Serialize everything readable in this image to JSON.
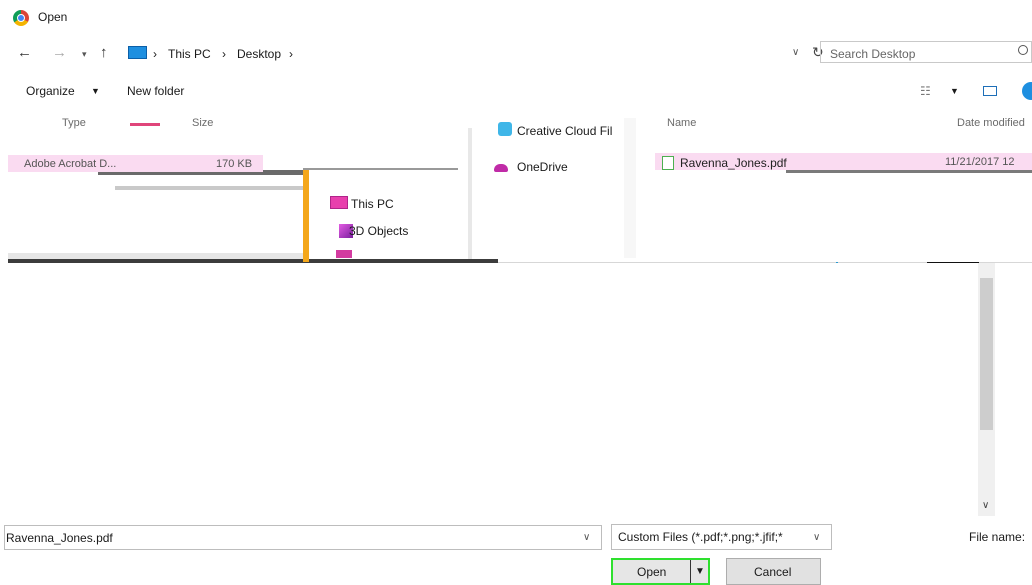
{
  "window": {
    "title": "Open"
  },
  "address": {
    "breadcrumbs": [
      "This PC",
      "Desktop"
    ],
    "separator": "›",
    "search_placeholder": "Search Desktop"
  },
  "toolbar": {
    "organize_label": "Organize",
    "new_folder_label": "New folder"
  },
  "columns": {
    "type": "Type",
    "size": "Size",
    "name": "Name",
    "date_modified": "Date modified"
  },
  "left_fragment": {
    "name": "Adobe Acrobat D...",
    "size": "170 KB"
  },
  "navigation": {
    "items": [
      {
        "label": "Creative Cloud Fil",
        "icon": "creative-cloud-icon"
      },
      {
        "label": "OneDrive",
        "icon": "onedrive-icon"
      },
      {
        "label": "This PC",
        "icon": "computer-icon"
      },
      {
        "label": "3D Objects",
        "icon": "3d-objects-icon"
      }
    ]
  },
  "file_list": {
    "selected_file": {
      "name": "Ravenna_Jones.pdf",
      "date": "11/21/2017 12"
    }
  },
  "bottom": {
    "file_name_label": "File name:",
    "file_name_value": "Ravenna_Jones.pdf",
    "file_type_value": "Custom Files (*.pdf;*.png;*.jfif;*",
    "open_label": "Open",
    "cancel_label": "Cancel"
  },
  "colors": {
    "accent_pink": "#fadbf1",
    "focus_green": "#2ee02e",
    "orange": "#f4a71b"
  }
}
